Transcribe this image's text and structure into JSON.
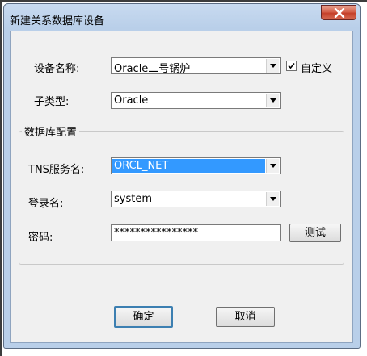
{
  "window": {
    "title": "新建关系数据库设备",
    "close_icon": "close-icon"
  },
  "form": {
    "device_name_label": "设备名称:",
    "device_name_value": "Oracle二号锅炉",
    "custom_checkbox_label": "自定义",
    "custom_checked": true,
    "subtype_label": "子类型:",
    "subtype_value": "Oracle"
  },
  "db_config": {
    "group_title": "数据库配置",
    "tns_label": "TNS服务名:",
    "tns_value": "ORCL_NET",
    "login_label": "登录名:",
    "login_value": "system",
    "password_label": "密码:",
    "password_value": "****************",
    "test_button": "测试"
  },
  "buttons": {
    "ok": "确定",
    "cancel": "取消"
  },
  "colors": {
    "selection": "#3399ff",
    "close_button": "#c4402a"
  }
}
